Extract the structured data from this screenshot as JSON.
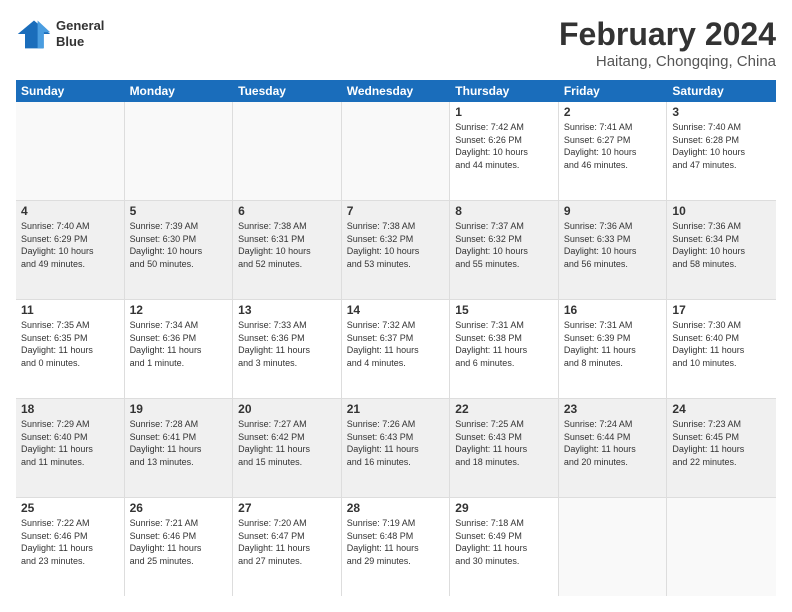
{
  "logo": {
    "line1": "General",
    "line2": "Blue"
  },
  "title": "February 2024",
  "location": "Haitang, Chongqing, China",
  "days_header": [
    "Sunday",
    "Monday",
    "Tuesday",
    "Wednesday",
    "Thursday",
    "Friday",
    "Saturday"
  ],
  "weeks": [
    [
      {
        "day": "",
        "info": ""
      },
      {
        "day": "",
        "info": ""
      },
      {
        "day": "",
        "info": ""
      },
      {
        "day": "",
        "info": ""
      },
      {
        "day": "1",
        "info": "Sunrise: 7:42 AM\nSunset: 6:26 PM\nDaylight: 10 hours\nand 44 minutes."
      },
      {
        "day": "2",
        "info": "Sunrise: 7:41 AM\nSunset: 6:27 PM\nDaylight: 10 hours\nand 46 minutes."
      },
      {
        "day": "3",
        "info": "Sunrise: 7:40 AM\nSunset: 6:28 PM\nDaylight: 10 hours\nand 47 minutes."
      }
    ],
    [
      {
        "day": "4",
        "info": "Sunrise: 7:40 AM\nSunset: 6:29 PM\nDaylight: 10 hours\nand 49 minutes."
      },
      {
        "day": "5",
        "info": "Sunrise: 7:39 AM\nSunset: 6:30 PM\nDaylight: 10 hours\nand 50 minutes."
      },
      {
        "day": "6",
        "info": "Sunrise: 7:38 AM\nSunset: 6:31 PM\nDaylight: 10 hours\nand 52 minutes."
      },
      {
        "day": "7",
        "info": "Sunrise: 7:38 AM\nSunset: 6:32 PM\nDaylight: 10 hours\nand 53 minutes."
      },
      {
        "day": "8",
        "info": "Sunrise: 7:37 AM\nSunset: 6:32 PM\nDaylight: 10 hours\nand 55 minutes."
      },
      {
        "day": "9",
        "info": "Sunrise: 7:36 AM\nSunset: 6:33 PM\nDaylight: 10 hours\nand 56 minutes."
      },
      {
        "day": "10",
        "info": "Sunrise: 7:36 AM\nSunset: 6:34 PM\nDaylight: 10 hours\nand 58 minutes."
      }
    ],
    [
      {
        "day": "11",
        "info": "Sunrise: 7:35 AM\nSunset: 6:35 PM\nDaylight: 11 hours\nand 0 minutes."
      },
      {
        "day": "12",
        "info": "Sunrise: 7:34 AM\nSunset: 6:36 PM\nDaylight: 11 hours\nand 1 minute."
      },
      {
        "day": "13",
        "info": "Sunrise: 7:33 AM\nSunset: 6:36 PM\nDaylight: 11 hours\nand 3 minutes."
      },
      {
        "day": "14",
        "info": "Sunrise: 7:32 AM\nSunset: 6:37 PM\nDaylight: 11 hours\nand 4 minutes."
      },
      {
        "day": "15",
        "info": "Sunrise: 7:31 AM\nSunset: 6:38 PM\nDaylight: 11 hours\nand 6 minutes."
      },
      {
        "day": "16",
        "info": "Sunrise: 7:31 AM\nSunset: 6:39 PM\nDaylight: 11 hours\nand 8 minutes."
      },
      {
        "day": "17",
        "info": "Sunrise: 7:30 AM\nSunset: 6:40 PM\nDaylight: 11 hours\nand 10 minutes."
      }
    ],
    [
      {
        "day": "18",
        "info": "Sunrise: 7:29 AM\nSunset: 6:40 PM\nDaylight: 11 hours\nand 11 minutes."
      },
      {
        "day": "19",
        "info": "Sunrise: 7:28 AM\nSunset: 6:41 PM\nDaylight: 11 hours\nand 13 minutes."
      },
      {
        "day": "20",
        "info": "Sunrise: 7:27 AM\nSunset: 6:42 PM\nDaylight: 11 hours\nand 15 minutes."
      },
      {
        "day": "21",
        "info": "Sunrise: 7:26 AM\nSunset: 6:43 PM\nDaylight: 11 hours\nand 16 minutes."
      },
      {
        "day": "22",
        "info": "Sunrise: 7:25 AM\nSunset: 6:43 PM\nDaylight: 11 hours\nand 18 minutes."
      },
      {
        "day": "23",
        "info": "Sunrise: 7:24 AM\nSunset: 6:44 PM\nDaylight: 11 hours\nand 20 minutes."
      },
      {
        "day": "24",
        "info": "Sunrise: 7:23 AM\nSunset: 6:45 PM\nDaylight: 11 hours\nand 22 minutes."
      }
    ],
    [
      {
        "day": "25",
        "info": "Sunrise: 7:22 AM\nSunset: 6:46 PM\nDaylight: 11 hours\nand 23 minutes."
      },
      {
        "day": "26",
        "info": "Sunrise: 7:21 AM\nSunset: 6:46 PM\nDaylight: 11 hours\nand 25 minutes."
      },
      {
        "day": "27",
        "info": "Sunrise: 7:20 AM\nSunset: 6:47 PM\nDaylight: 11 hours\nand 27 minutes."
      },
      {
        "day": "28",
        "info": "Sunrise: 7:19 AM\nSunset: 6:48 PM\nDaylight: 11 hours\nand 29 minutes."
      },
      {
        "day": "29",
        "info": "Sunrise: 7:18 AM\nSunset: 6:49 PM\nDaylight: 11 hours\nand 30 minutes."
      },
      {
        "day": "",
        "info": ""
      },
      {
        "day": "",
        "info": ""
      }
    ]
  ]
}
